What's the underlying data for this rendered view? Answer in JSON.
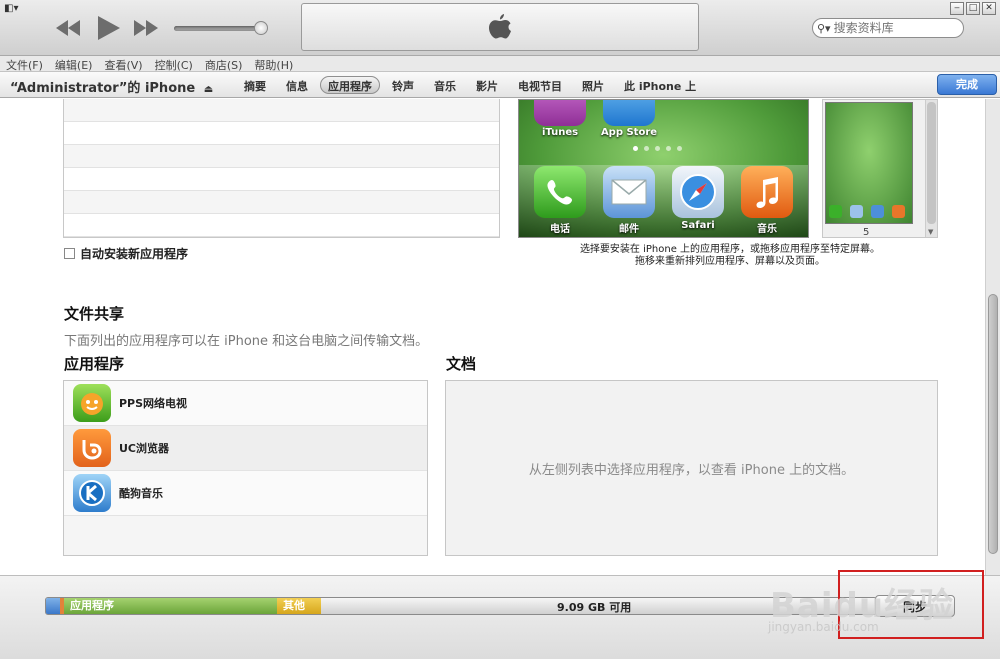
{
  "window": {
    "search_placeholder": "搜索资料库"
  },
  "menu": [
    "文件(F)",
    "编辑(E)",
    "查看(V)",
    "控制(C)",
    "商店(S)",
    "帮助(H)"
  ],
  "device": {
    "name": "“Administrator”的 iPhone"
  },
  "tabs": [
    "摘要",
    "信息",
    "应用程序",
    "铃声",
    "音乐",
    "影片",
    "电视节目",
    "照片",
    "此 iPhone 上"
  ],
  "active_tab": "应用程序",
  "done_label": "完成",
  "apps_section": {
    "auto_install_label": "自动安装新应用程序",
    "phone_apps_top": [
      "iTunes",
      "App Store"
    ],
    "phone_dock": [
      "电话",
      "邮件",
      "Safari",
      "音乐"
    ],
    "screen_page_number": "5",
    "hint_line1": "选择要安装在 iPhone 上的应用程序，或拖移应用程序至特定屏幕。",
    "hint_line2": "拖移来重新排列应用程序、屏幕以及页面。"
  },
  "file_sharing": {
    "title": "文件共享",
    "description": "下面列出的应用程序可以在 iPhone 和这台电脑之间传输文档。",
    "apps_header": "应用程序",
    "docs_header": "文档",
    "apps": [
      "PPS网络电视",
      "UC浏览器",
      "酷狗音乐"
    ],
    "docs_empty": "从左侧列表中选择应用程序，以查看 iPhone 上的文档。"
  },
  "capacity": {
    "apps_label": "应用程序",
    "other_label": "其他",
    "free_label": "9.09 GB 可用"
  },
  "sync_label": "同步",
  "watermark": {
    "main": "Baidu经验",
    "sub": "jingyan.baidu.com"
  },
  "colors": {
    "accent_blue": "#3a78d4",
    "apps_green": "#6ba53a",
    "other_yellow": "#d6a61c",
    "highlight_red": "#d11f1f"
  }
}
